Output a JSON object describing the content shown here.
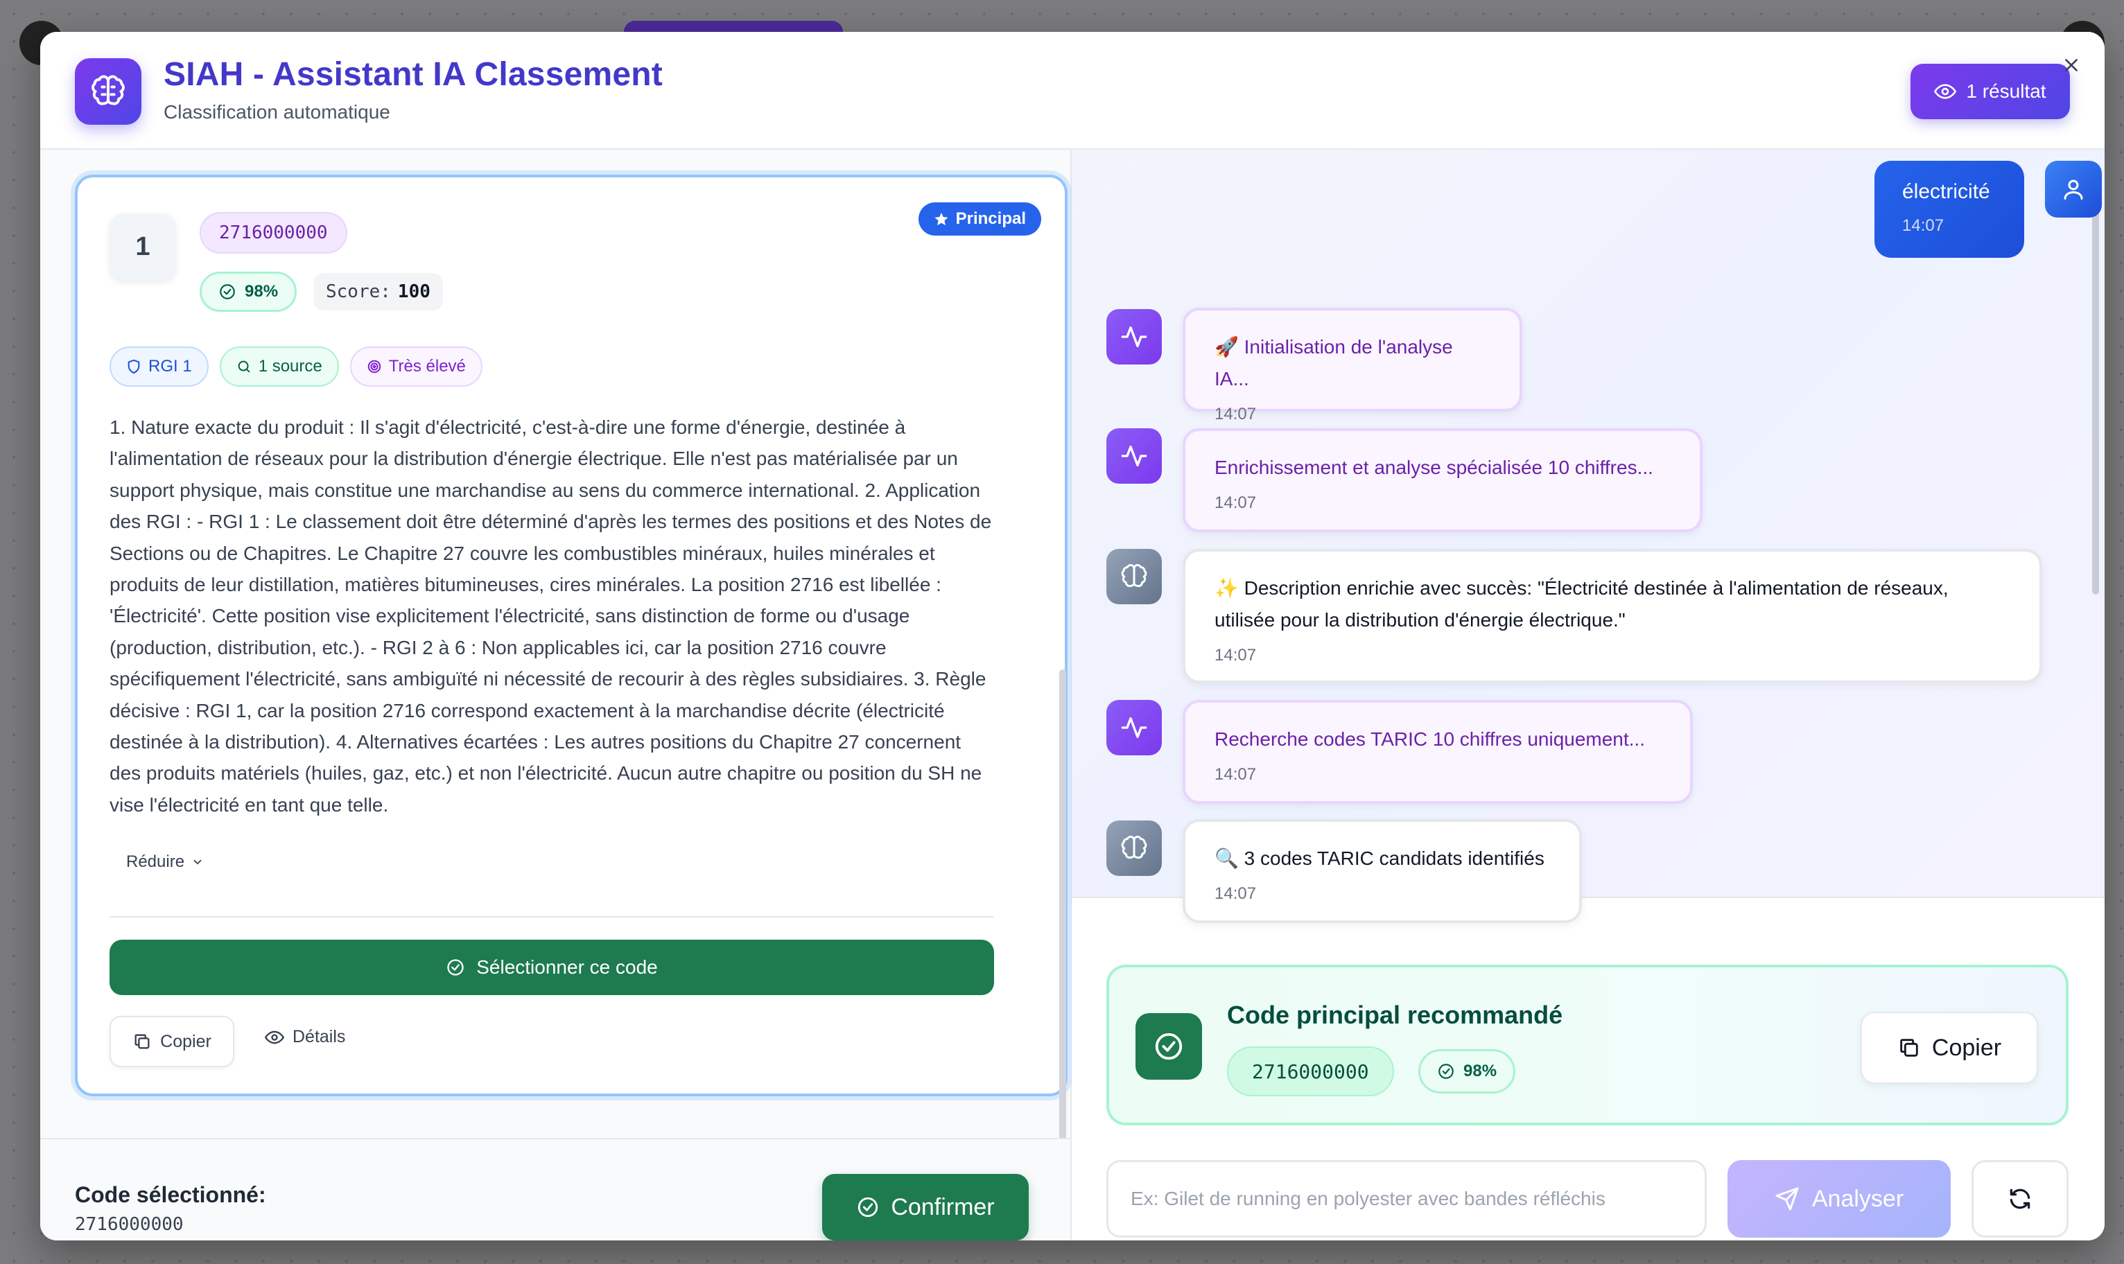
{
  "header": {
    "title": "SIAH - Assistant IA Classement",
    "subtitle": "Classification automatique",
    "results_label": "1 résultat"
  },
  "card": {
    "rank": "1",
    "code": "2716000000",
    "confidence": "98%",
    "score_label": "Score:",
    "score_value": "100",
    "principal_label": "Principal",
    "tags": {
      "rgi": "RGI 1",
      "source": "1 source",
      "level": "Très élevé"
    },
    "explanation": "1. Nature exacte du produit : Il s'agit d'électricité, c'est-à-dire une forme d'énergie, destinée à l'alimentation de réseaux pour la distribution d'énergie électrique. Elle n'est pas matérialisée par un support physique, mais constitue une marchandise au sens du commerce international. 2. Application des RGI : - RGI 1 : Le classement doit être déterminé d'après les termes des positions et des Notes de Sections ou de Chapitres. Le Chapitre 27 couvre les combustibles minéraux, huiles minérales et produits de leur distillation, matières bitumineuses, cires minérales. La position 2716 est libellée : 'Électricité'. Cette position vise explicitement l'électricité, sans distinction de forme ou d'usage (production, distribution, etc.). - RGI 2 à 6 : Non applicables ici, car la position 2716 couvre spécifiquement l'électricité, sans ambiguïté ni nécessité de recourir à des règles subsidiaires. 3. Règle décisive : RGI 1, car la position 2716 correspond exactement à la marchandise décrite (électricité destinée à la distribution). 4. Alternatives écartées : Les autres positions du Chapitre 27 concernent des produits matériels (huiles, gaz, etc.) et non l'électricité. Aucun autre chapitre ou position du SH ne vise l'électricité en tant que telle.",
    "reduce_label": "Réduire",
    "select_label": "Sélectionner ce code",
    "copy_label": "Copier",
    "details_label": "Détails"
  },
  "footer_left": {
    "selected_label": "Code sélectionné:",
    "selected_value": "2716000000",
    "confirm_label": "Confirmer"
  },
  "chat": {
    "user_message": {
      "text": "électricité",
      "time": "14:07"
    },
    "messages": [
      {
        "text": "🚀 Initialisation de l'analyse IA...",
        "time": "14:07",
        "style": "purple",
        "icon": "activity-icon"
      },
      {
        "text": "Enrichissement et analyse spécialisée 10 chiffres...",
        "time": "14:07",
        "style": "purple",
        "icon": "activity-icon"
      },
      {
        "text": "✨ Description enrichie avec succès: \"Électricité destinée à l'alimentation de réseaux, utilisée pour la distribution d'énergie électrique.\"",
        "time": "14:07",
        "style": "white",
        "icon": "brain-icon"
      },
      {
        "text": "Recherche codes TARIC 10 chiffres uniquement...",
        "time": "14:07",
        "style": "purple",
        "icon": "activity-icon"
      },
      {
        "text": "🔍 3 codes TARIC candidats identifiés",
        "time": "14:07",
        "style": "white",
        "icon": "brain-icon"
      }
    ]
  },
  "recommendation": {
    "title": "Code principal recommandé",
    "code": "2716000000",
    "confidence": "98%",
    "copy_label": "Copier"
  },
  "input": {
    "placeholder": "Ex: Gilet de running en polyester avec bandes réfléchis",
    "analyze_label": "Analyser"
  },
  "colors": {
    "accent": "#4f46e5",
    "success": "#1e7a4f",
    "user_bubble": "#2563eb"
  }
}
